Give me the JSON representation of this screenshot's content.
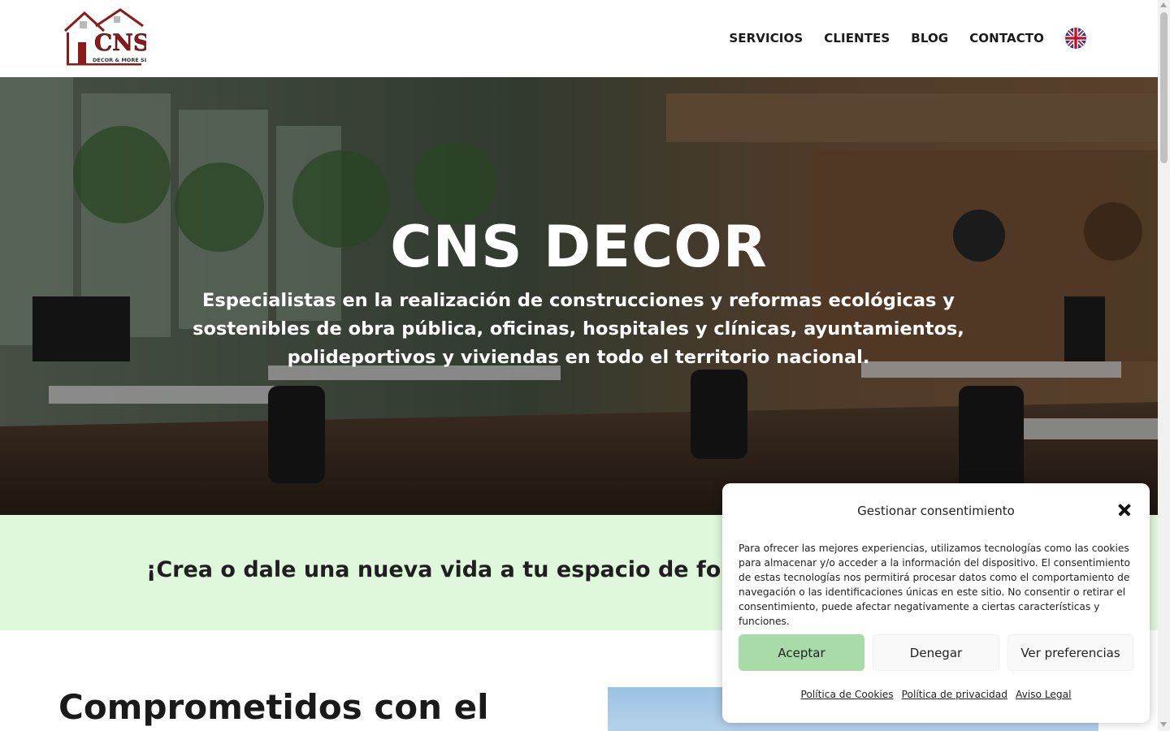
{
  "header": {
    "logo": {
      "brand": "CNS",
      "tagline": "DECOR & MORE SL"
    },
    "nav": [
      {
        "label": "SERVICIOS"
      },
      {
        "label": "CLIENTES"
      },
      {
        "label": "BLOG"
      },
      {
        "label": "CONTACTO"
      }
    ],
    "language_icon": "uk-flag-icon"
  },
  "hero": {
    "title": "CNS DECOR",
    "subtitle": "Especialistas en la realización de construcciones y reformas ecológicas y sostenibles de obra pública, oficinas, hospitales y clínicas, ayuntamientos, polideportivos y viviendas en todo el territorio nacional."
  },
  "band": {
    "text": "¡Crea o dale una nueva vida a tu espacio de forma so"
  },
  "section": {
    "title": "Comprometidos con el"
  },
  "consent": {
    "title": "Gestionar consentimiento",
    "body": "Para ofrecer las mejores experiencias, utilizamos tecnologías como las cookies para almacenar y/o acceder a la información del dispositivo. El consentimiento de estas tecnologías nos permitirá procesar datos como el comportamiento de navegación o las identificaciones únicas en este sitio. No consentir o retirar el consentimiento, puede afectar negativamente a ciertas características y funciones.",
    "buttons": {
      "accept": "Aceptar",
      "deny": "Denegar",
      "preferences": "Ver preferencias"
    },
    "links": [
      {
        "label": "Política de Cookies"
      },
      {
        "label": "Política de privacidad"
      },
      {
        "label": "Aviso Legal"
      }
    ]
  },
  "colors": {
    "band_bg": "#dff8dc",
    "accept_button": "#a8dba8",
    "logo_red": "#8b1a1a"
  }
}
